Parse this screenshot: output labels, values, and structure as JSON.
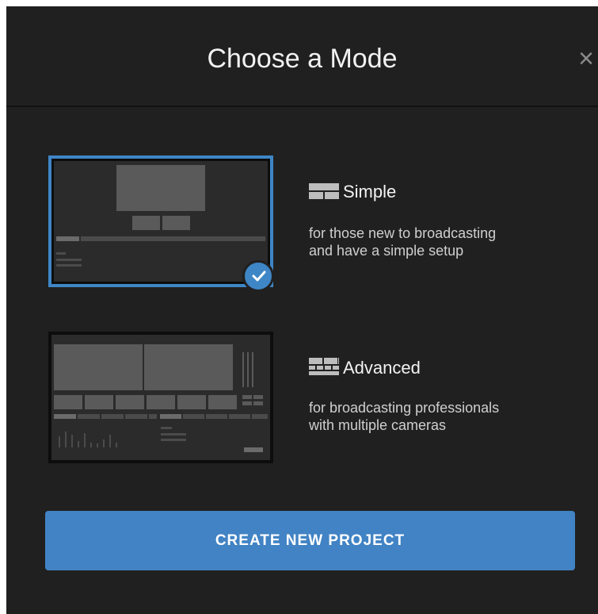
{
  "dialog": {
    "title": "Choose a Mode",
    "close_symbol": "×"
  },
  "modes": [
    {
      "name": "Simple",
      "icon": "simple-layout-icon",
      "description_line1": "for those new to broadcasting",
      "description_line2": "and have a simple setup",
      "selected": true
    },
    {
      "name": "Advanced",
      "icon": "advanced-layout-icon",
      "description_line1": "for broadcasting professionals",
      "description_line2": "with multiple cameras",
      "selected": false
    }
  ],
  "cta": {
    "label": "CREATE NEW PROJECT"
  },
  "colors": {
    "background": "#202020",
    "accent": "#4183c4",
    "selected_border": "#3f86c6",
    "text_primary": "#f2f2f2",
    "text_secondary": "#cfcfcf"
  }
}
